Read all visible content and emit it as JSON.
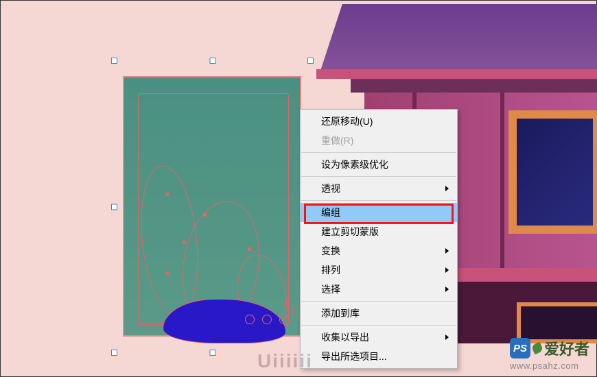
{
  "menu": {
    "undo": "还原移动(U)",
    "redo": "重做(R)",
    "pixel_optimize": "设为像素级优化",
    "perspective": "透视",
    "group": "编组",
    "clipping_mask": "建立剪切蒙版",
    "transform": "变换",
    "arrange": "排列",
    "select": "选择",
    "add_to_library": "添加到库",
    "collect_export": "收集以导出",
    "export_selection": "导出所选项目..."
  },
  "watermark": {
    "ps": "PS",
    "brand": "爱好者",
    "url": "www.psahz.com",
    "uiii": "Uiiiiii"
  },
  "colors": {
    "menu_hover": "#91c9f7",
    "highlight": "#ef1818"
  }
}
